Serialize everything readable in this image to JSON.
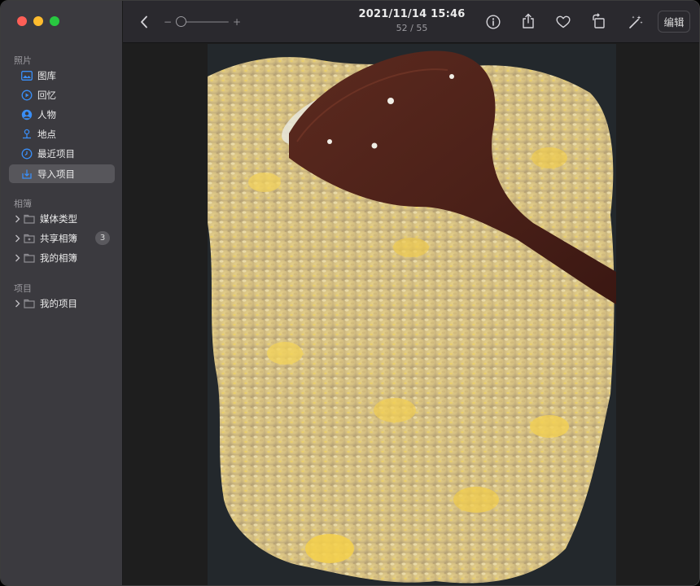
{
  "sidebar": {
    "sections": [
      {
        "title": "照片"
      },
      {
        "title": "相簿"
      },
      {
        "title": "项目"
      }
    ],
    "library_items": [
      {
        "label": "图库",
        "icon": "photo-library-icon"
      },
      {
        "label": "回忆",
        "icon": "memories-icon"
      },
      {
        "label": "人物",
        "icon": "people-icon"
      },
      {
        "label": "地点",
        "icon": "places-icon"
      },
      {
        "label": "最近项目",
        "icon": "recents-icon"
      },
      {
        "label": "导入项目",
        "icon": "import-icon"
      }
    ],
    "album_items": [
      {
        "label": "媒体类型",
        "icon": "folder-icon"
      },
      {
        "label": "共享相簿",
        "icon": "shared-folder-icon",
        "badge": "3"
      },
      {
        "label": "我的相簿",
        "icon": "folder-icon"
      }
    ],
    "project_items": [
      {
        "label": "我的项目",
        "icon": "folder-icon"
      }
    ],
    "active_item": "导入项目"
  },
  "toolbar": {
    "title": "2021/11/14 15:46",
    "counter": "52 / 55",
    "zoom_minus": "−",
    "zoom_plus": "+",
    "zoom_level": 0.0,
    "edit_label": "编辑",
    "icons": [
      "back-chevron-icon",
      "info-icon",
      "share-icon",
      "heart-icon",
      "rotate-icon",
      "magic-wand-icon"
    ]
  },
  "colors": {
    "accent": "#3a8ef6",
    "sidebar_bg": "#3b3a3f",
    "toolbar_bg": "#2a292e",
    "close": "#fe5f57",
    "minimize": "#febc2e",
    "zoom": "#28c840"
  },
  "viewer": {
    "subject": "photo-fried-rice-in-wok"
  }
}
